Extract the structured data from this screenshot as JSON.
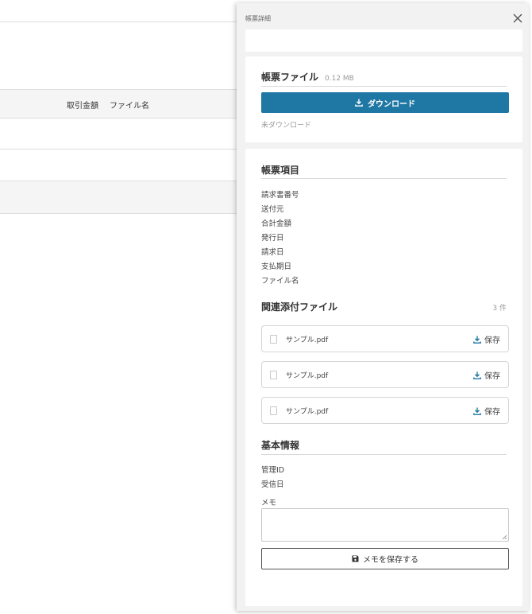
{
  "background_table": {
    "columns": [
      "取引金額",
      "ファイル名"
    ]
  },
  "drawer": {
    "title": "帳票詳細",
    "close_icon": "close-icon",
    "file_section": {
      "title": "帳票ファイル",
      "size": "0.12 MB",
      "download_label": "ダウンロード",
      "status": "未ダウンロード"
    },
    "items_section": {
      "title": "帳票項目",
      "fields": [
        "請求書番号",
        "送付元",
        "合計金額",
        "発行日",
        "請求日",
        "支払期日",
        "ファイル名"
      ]
    },
    "attachments_section": {
      "title": "関連添付ファイル",
      "count": "3 件",
      "files": [
        {
          "name": "サンプル.pdf",
          "save_label": "保存"
        },
        {
          "name": "サンプル.pdf",
          "save_label": "保存"
        },
        {
          "name": "サンプル.pdf",
          "save_label": "保存"
        }
      ]
    },
    "basic_section": {
      "title": "基本情報",
      "fields": [
        "管理ID",
        "受信日"
      ],
      "memo_label": "メモ",
      "memo_value": "",
      "memo_save_label": "メモを保存する"
    },
    "colors": {
      "accent": "#1f77a4",
      "panel_bg": "#f2f2f2"
    }
  }
}
